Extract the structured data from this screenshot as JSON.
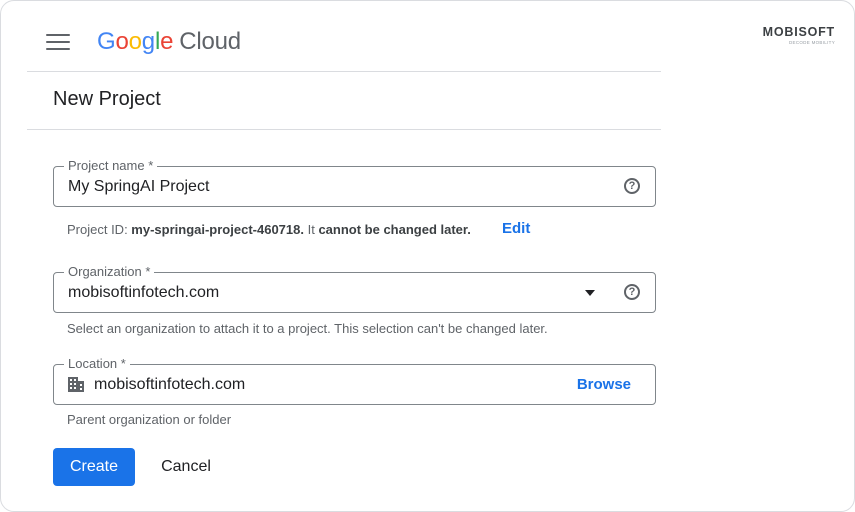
{
  "header": {
    "logo_letters": [
      "G",
      "o",
      "o",
      "g",
      "l",
      "e"
    ],
    "logo_product": "Cloud",
    "brand_name": "MOBISOFT",
    "brand_tagline": "DECODE MOBILITY"
  },
  "page": {
    "title": "New Project"
  },
  "project_name": {
    "label": "Project name *",
    "value": "My SpringAI Project",
    "hint_prefix": "Project ID: ",
    "project_id": "my-springai-project-460718.",
    "hint_middle": " It ",
    "hint_bold": "cannot be changed later.",
    "edit_label": "Edit"
  },
  "organization": {
    "label": "Organization *",
    "value": "mobisoftinfotech.com",
    "hint": "Select an organization to attach it to a project. This selection can't be changed later."
  },
  "location": {
    "label": "Location *",
    "value": "mobisoftinfotech.com",
    "browse_label": "Browse",
    "hint": "Parent organization or folder"
  },
  "actions": {
    "create_label": "Create",
    "cancel_label": "Cancel"
  },
  "icons": {
    "menu": "hamburger-menu-icon",
    "help": "help-circle-icon",
    "dropdown": "caret-down-icon",
    "location": "building-icon"
  },
  "colors": {
    "accent": "#1a73e8",
    "border": "#dadce0",
    "text": "#202124",
    "muted": "#5f6368"
  }
}
